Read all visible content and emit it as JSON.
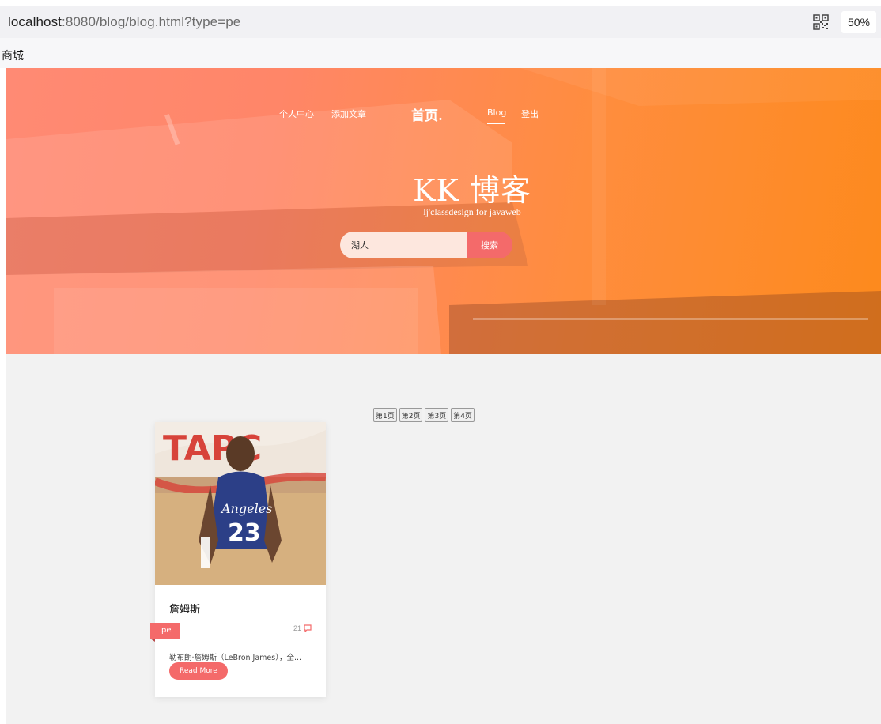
{
  "browser": {
    "url_host": "localhost",
    "url_rest": ":8080/blog/blog.html?type=pe",
    "zoom": "50%",
    "qr_icon": "qr-code-icon"
  },
  "tab": {
    "label": "商城"
  },
  "nav": {
    "profile": "个人中心",
    "add_article": "添加文章",
    "logo": "首页.",
    "blog": "Blog",
    "logout": "登出"
  },
  "hero": {
    "title": "KK 博客",
    "subtitle": "lj'classdesign for javaweb"
  },
  "search": {
    "value": "湖人",
    "button": "搜索"
  },
  "pagination": [
    {
      "label": "第1页"
    },
    {
      "label": "第2页"
    },
    {
      "label": "第3页"
    },
    {
      "label": "第4页"
    }
  ],
  "posts": [
    {
      "title": "詹姆斯",
      "tag": "pe",
      "comment_count": "21",
      "excerpt": "勒布朗·詹姆斯（LeBron James），全...",
      "read_more": "Read More",
      "image_icon": "basketball-player-photo"
    }
  ],
  "colors": {
    "accent": "#f46a6a",
    "hero_start": "#ff8a74",
    "hero_end": "#fd8a1c"
  }
}
